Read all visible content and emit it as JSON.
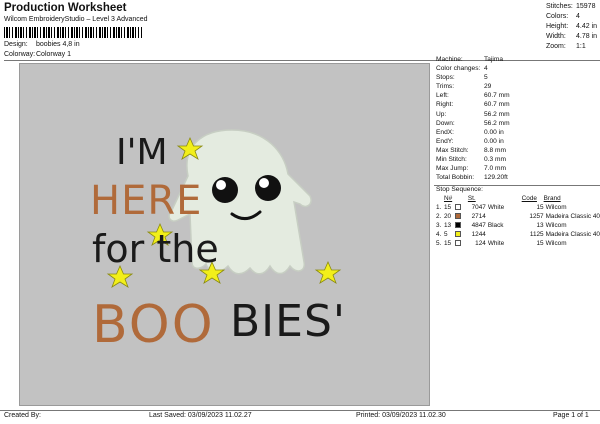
{
  "header": {
    "title": "Production Worksheet",
    "subtitle": "Wilcom EmbroideryStudio – Level 3 Advanced",
    "design_label": "Design:",
    "design_value": "boobies 4,8 in",
    "colorway_label": "Colorway:",
    "colorway_value": "Colorway 1"
  },
  "stats": [
    {
      "label": "Stitches:",
      "value": "15978"
    },
    {
      "label": "Colors:",
      "value": "4"
    },
    {
      "label": "Height:",
      "value": "4.42 in"
    },
    {
      "label": "Width:",
      "value": "4.78 in"
    },
    {
      "label": "Zoom:",
      "value": "1:1"
    }
  ],
  "machine_info": [
    {
      "label": "Machine:",
      "value": "Tajima"
    },
    {
      "label": "Color changes:",
      "value": "4"
    },
    {
      "label": "Stops:",
      "value": "5"
    },
    {
      "label": "Trims:",
      "value": "29"
    },
    {
      "label": "Left:",
      "value": "60.7 mm"
    },
    {
      "label": "Right:",
      "value": "60.7 mm"
    },
    {
      "label": "Up:",
      "value": "56.2 mm"
    },
    {
      "label": "Down:",
      "value": "56.2 mm"
    },
    {
      "label": "EndX:",
      "value": "0.00 in"
    },
    {
      "label": "EndY:",
      "value": "0.00 in"
    },
    {
      "label": "Max Stitch:",
      "value": "8.8 mm"
    },
    {
      "label": "Min Stitch:",
      "value": "0.3 mm"
    },
    {
      "label": "Max Jump:",
      "value": "7.0 mm"
    },
    {
      "label": "Total Bobbin:",
      "value": "129.20ft"
    }
  ],
  "stop_sequence": {
    "title": "Stop Sequence:",
    "headers": {
      "n": "N#",
      "st": "St.",
      "code": "Code",
      "brand": "Brand"
    },
    "rows": [
      {
        "idx": "1.",
        "n": "15",
        "color": "#ffffff",
        "st": "7047",
        "name": "White",
        "code": "15",
        "brand": "Wilcom"
      },
      {
        "idx": "2.",
        "n": "20",
        "color": "#b06a3a",
        "st": "2714",
        "name": "",
        "code": "1257",
        "brand": "Madeira Classic 40"
      },
      {
        "idx": "3.",
        "n": "13",
        "color": "#000000",
        "st": "4847",
        "name": "Black",
        "code": "13",
        "brand": "Wilcom"
      },
      {
        "idx": "4.",
        "n": "5",
        "color": "#f2ef1a",
        "st": "1244",
        "name": "",
        "code": "1125",
        "brand": "Madeira Classic 40"
      },
      {
        "idx": "5.",
        "n": "15",
        "color": "#ffffff",
        "st": "124",
        "name": "White",
        "code": "15",
        "brand": "Wilcom"
      }
    ]
  },
  "design_text": {
    "line1": "I'M",
    "line2": "HERE",
    "line3": "for the",
    "line4a": "BOO",
    "line4b": "BIES'"
  },
  "footer": {
    "created_by": "Created By:",
    "last_saved": "Last Saved: 03/09/2023 11.02.27",
    "printed": "Printed: 03/09/2023 11.02.30",
    "page": "Page 1 of 1"
  },
  "colors": {
    "canvas": "#c2c2c2",
    "ghost": "#e4ebe0",
    "orange": "#b06a3a",
    "black": "#1a1a1a",
    "star": "#f2ef1a"
  }
}
